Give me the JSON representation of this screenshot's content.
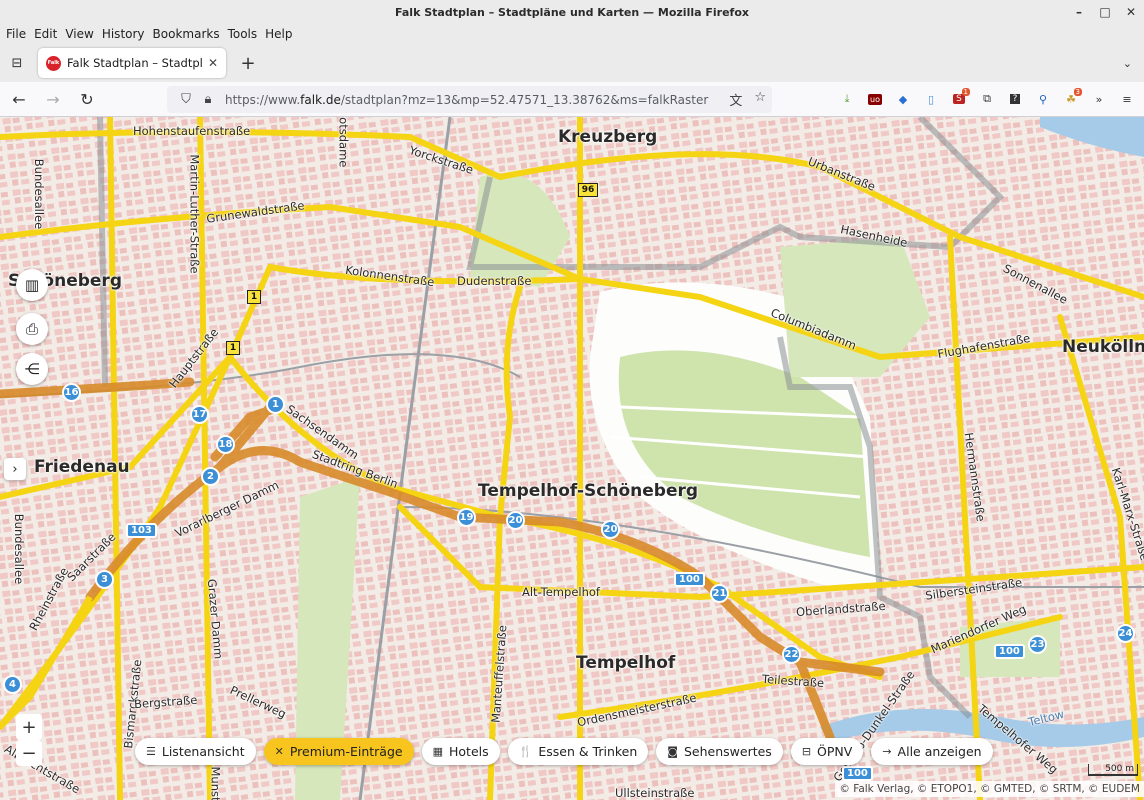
{
  "window": {
    "title": "Falk Stadtplan – Stadtpläne und Karten — Mozilla Firefox",
    "minimize": "–",
    "maximize": "□",
    "close": "✕"
  },
  "menu": [
    "File",
    "Edit",
    "View",
    "History",
    "Bookmarks",
    "Tools",
    "Help"
  ],
  "tab": {
    "title": "Falk Stadtplan – Stadtpläne",
    "favicon": "falk",
    "close": "✕"
  },
  "newtab": "+",
  "nav": {
    "back": "←",
    "forward": "→",
    "reload": "↻"
  },
  "url": {
    "prefix": "https://www.",
    "domain": "falk.de",
    "path": "/stadtplan?mz=13&mp=52.47571_13.38762&ms=falkRaster"
  },
  "extensions": {
    "badge_s": "1",
    "badge_last": "3"
  },
  "map": {
    "districts": [
      "Kreuzberg",
      "Schöneberg",
      "Friedenau",
      "Tempelhof-Schöneberg",
      "Tempelhof",
      "Neukölln"
    ],
    "streets": [
      "Hohenstaufenstraße",
      "Yorckstraße",
      "Urbanstraße",
      "Grunewaldstraße",
      "Hasenheide",
      "Sonnenallee",
      "Kolonnenstraße",
      "Dudenstraße",
      "Columbiadamm",
      "Flughafenstraße",
      "Hauptstraße",
      "Sachsendamm",
      "Stadtring Berlin",
      "Vorarlberger Damm",
      "Saarstraße",
      "Rheinstraße",
      "Bundesallee",
      "Bundesallee",
      "Martin-Luther-Straße",
      "Potsdame",
      "Hermannstraße",
      "Karl-Marx-Straße",
      "Alt-Tempelhof",
      "Oberlandstraße",
      "Silbersteinstraße",
      "Mariendorfer Weg",
      "Manteuffelstraße",
      "Grazer Damm",
      "Bismarckstraße",
      "Bergstraße",
      "Prellerweg",
      "Teilestraße",
      "Ordensmeisterstraße",
      "Gottlieb-Dunkel-Straße",
      "Teltow",
      "Albrechtstraße",
      "Ullsteinstraße",
      "Tempelhofer Weg",
      "Munst"
    ],
    "route_circles": [
      "16",
      "17",
      "1",
      "18",
      "2",
      "3",
      "4",
      "19",
      "20",
      "20",
      "21",
      "22",
      "23",
      "24"
    ],
    "route_rects": [
      "103",
      "100",
      "100",
      "100"
    ],
    "b_shields": [
      "96",
      "1",
      "1"
    ],
    "scale": "500 m",
    "attribution": "© Falk Verlag, © ETOPO1, © GMTED, © SRTM, © EUDEM"
  },
  "chips": [
    {
      "icon": "list-icon",
      "glyph": "☰",
      "label": "Listenansicht"
    },
    {
      "icon": "close-icon",
      "glyph": "✕",
      "label": "Premium-Einträge"
    },
    {
      "icon": "hotel-icon",
      "glyph": "▦",
      "label": "Hotels"
    },
    {
      "icon": "food-icon",
      "glyph": "🍴",
      "label": "Essen & Trinken"
    },
    {
      "icon": "camera-icon",
      "glyph": "◙",
      "label": "Sehenswertes"
    },
    {
      "icon": "bus-icon",
      "glyph": "⊟",
      "label": "ÖPNV"
    },
    {
      "icon": "arrow-right-icon",
      "glyph": "→",
      "label": "Alle anzeigen"
    }
  ],
  "zoom": {
    "in": "+",
    "out": "−"
  },
  "colors": {
    "road": "#f5d414",
    "highway": "#d88b2a",
    "park": "#d4e6b5",
    "water": "#a5cbe8",
    "premium": "#f8c51e"
  }
}
